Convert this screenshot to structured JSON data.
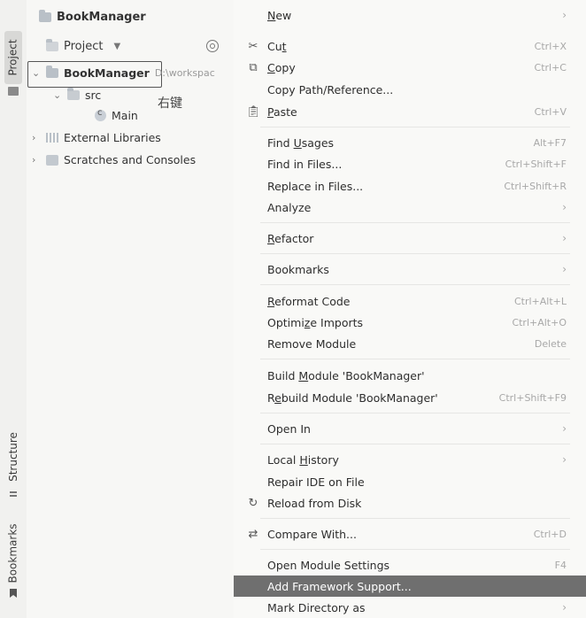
{
  "sidebar_tabs": {
    "project": "Project",
    "structure": "Structure",
    "bookmarks": "Bookmarks"
  },
  "panel": {
    "title": "BookManager",
    "view_selector": "Project",
    "annotation": "右键",
    "tree": {
      "root_name": "BookManager",
      "root_path": "D:\\workspac",
      "src": "src",
      "main": "Main",
      "external_libraries": "External Libraries",
      "scratches": "Scratches and Consoles"
    }
  },
  "menu": {
    "new": {
      "label": "New"
    },
    "cut": {
      "label": "Cut",
      "shortcut": "Ctrl+X"
    },
    "copy": {
      "label": "Copy",
      "shortcut": "Ctrl+C"
    },
    "copy_path": {
      "label": "Copy Path/Reference..."
    },
    "paste": {
      "label": "Paste",
      "shortcut": "Ctrl+V"
    },
    "find_usages": {
      "label": "Find Usages",
      "shortcut": "Alt+F7"
    },
    "find_in_files": {
      "label": "Find in Files...",
      "shortcut": "Ctrl+Shift+F"
    },
    "replace_in_files": {
      "label": "Replace in Files...",
      "shortcut": "Ctrl+Shift+R"
    },
    "analyze": {
      "label": "Analyze"
    },
    "refactor": {
      "label": "Refactor"
    },
    "bookmarks": {
      "label": "Bookmarks"
    },
    "reformat_code": {
      "label": "Reformat Code",
      "shortcut": "Ctrl+Alt+L"
    },
    "optimize_imports": {
      "label": "Optimize Imports",
      "shortcut": "Ctrl+Alt+O"
    },
    "remove_module": {
      "label": "Remove Module",
      "shortcut": "Delete"
    },
    "build_module": {
      "label": "Build Module 'BookManager'"
    },
    "rebuild_module": {
      "label": "Rebuild Module 'BookManager'",
      "shortcut": "Ctrl+Shift+F9"
    },
    "open_in": {
      "label": "Open In"
    },
    "local_history": {
      "label": "Local History"
    },
    "repair_ide": {
      "label": "Repair IDE on File"
    },
    "reload_from_disk": {
      "label": "Reload from Disk"
    },
    "compare_with": {
      "label": "Compare With...",
      "shortcut": "Ctrl+D"
    },
    "open_module_settings": {
      "label": "Open Module Settings",
      "shortcut": "F4"
    },
    "add_framework_support": {
      "label": "Add Framework Support..."
    },
    "mark_directory_as": {
      "label": "Mark Directory as"
    }
  },
  "colors": {
    "highlight": "#6f6f6f",
    "menu_bg": "#f9f9f7",
    "panel_bg": "#f7f7f5"
  }
}
